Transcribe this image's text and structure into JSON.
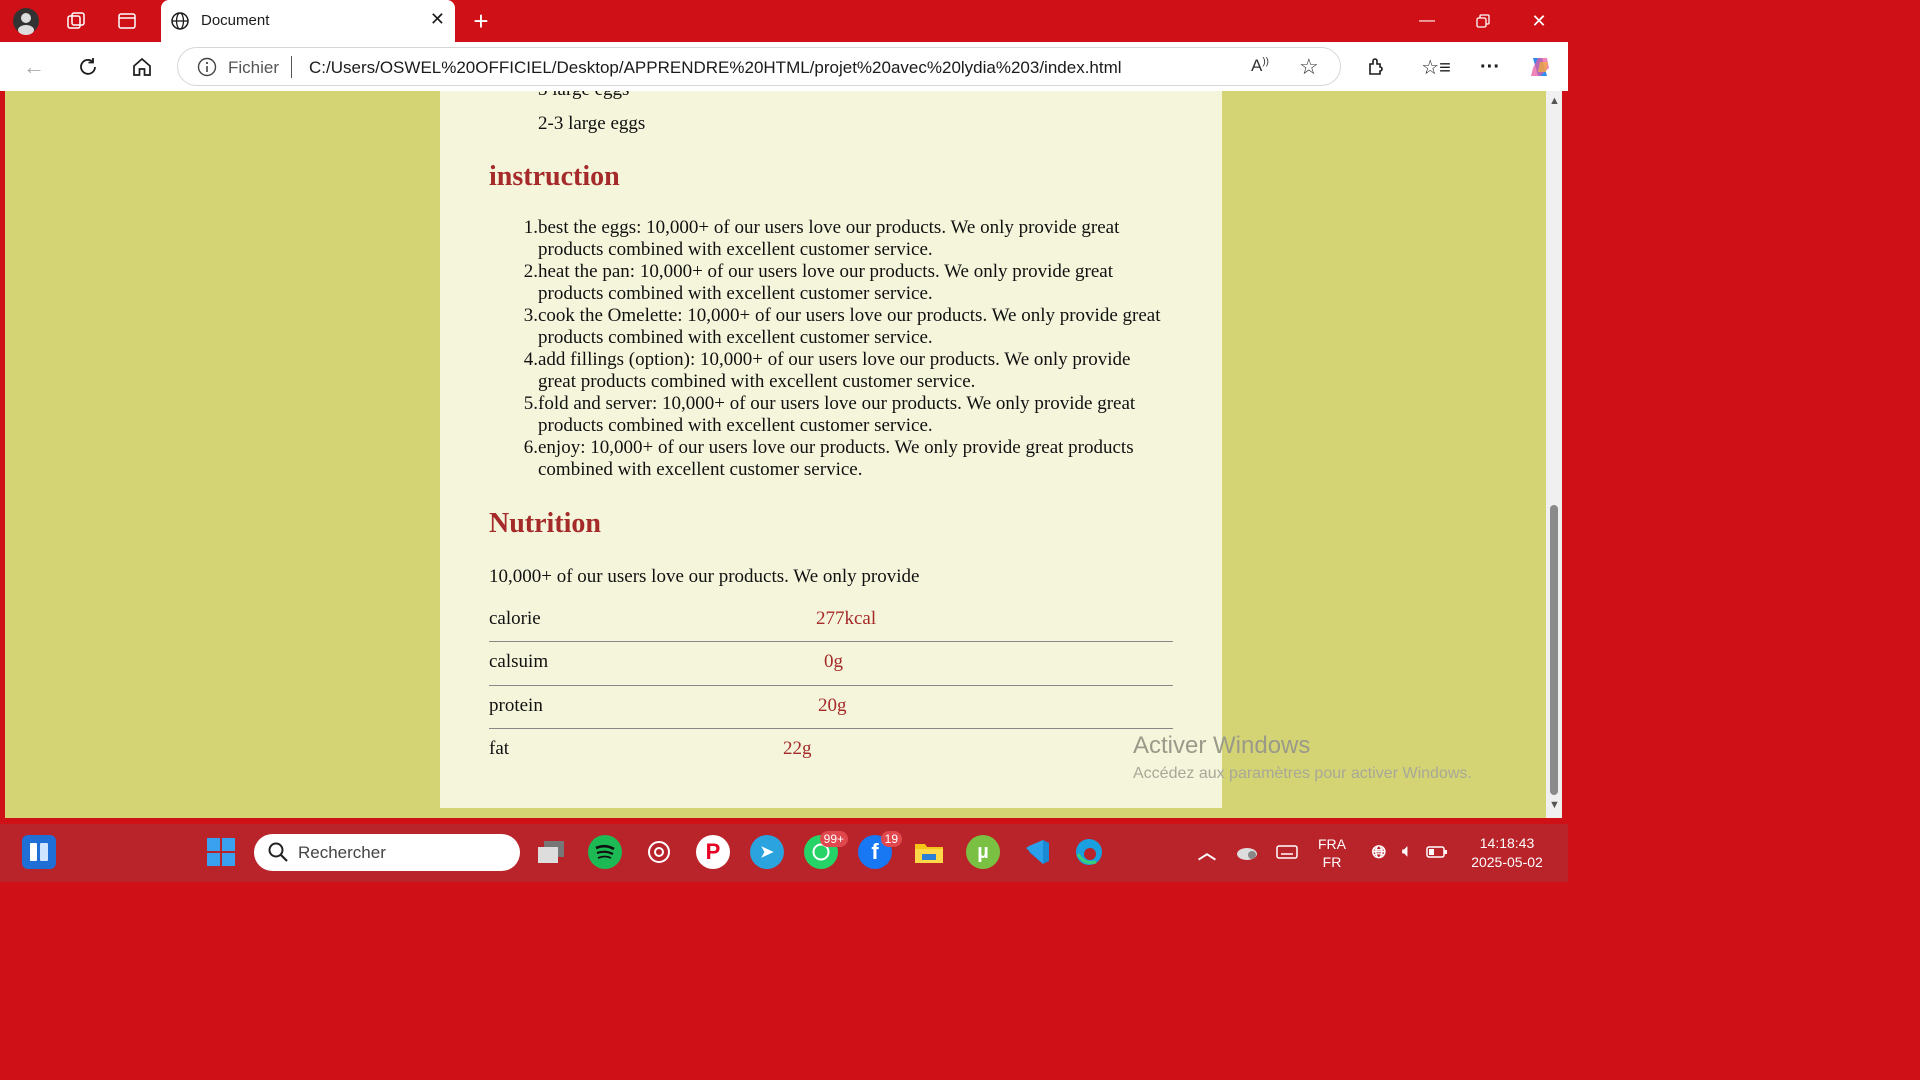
{
  "browser": {
    "tab_title": "Document",
    "address_scheme": "Fichier",
    "address_url": "C:/Users/OSWEL%20OFFICIEL/Desktop/APPRENDRE%20HTML/projet%20avec%20lydia%203/index.html"
  },
  "page": {
    "ingredient_last": "2-3 large eggs",
    "instruction_heading": "instruction",
    "steps": [
      {
        "num": "1.",
        "text": "best the eggs: 10,000+ of our users love our products. We only provide great products combined with excellent customer service."
      },
      {
        "num": "2.",
        "text": "heat the pan: 10,000+ of our users love our products. We only provide great products combined with excellent customer service."
      },
      {
        "num": "3.",
        "text": "cook the Omelette: 10,000+ of our users love our products. We only provide great products combined with excellent customer service."
      },
      {
        "num": "4.",
        "text": "add fillings (option): 10,000+ of our users love our products. We only provide great products combined with excellent customer service."
      },
      {
        "num": "5.",
        "text": "fold and server: 10,000+ of our users love our products. We only provide great products combined with excellent customer service."
      },
      {
        "num": "6.",
        "text": "enjoy: 10,000+ of our users love our products. We only provide great products combined with excellent customer service."
      }
    ],
    "nutrition_heading": "Nutrition",
    "nutrition_intro": "10,000+ of our users love our products. We only provide",
    "nutrition": [
      {
        "label": "calorie",
        "value": "277kcal"
      },
      {
        "label": "calsuim",
        "value": "0g"
      },
      {
        "label": "protein",
        "value": "20g"
      },
      {
        "label": "fat",
        "value": "22g"
      }
    ]
  },
  "watermark": {
    "title": "Activer Windows",
    "subtitle": "Accédez aux paramètres pour activer Windows."
  },
  "taskbar": {
    "search_placeholder": "Rechercher",
    "whatsapp_badge": "99+",
    "messenger_badge": "19",
    "lang_top": "FRA",
    "lang_bottom": "FR",
    "time": "14:18:43",
    "date": "2025-05-02"
  },
  "colors": {
    "accent_red": "#cf1016",
    "page_bg": "#d4d474",
    "content_bg": "#f5f5dc",
    "heading": "#a52a2a"
  }
}
